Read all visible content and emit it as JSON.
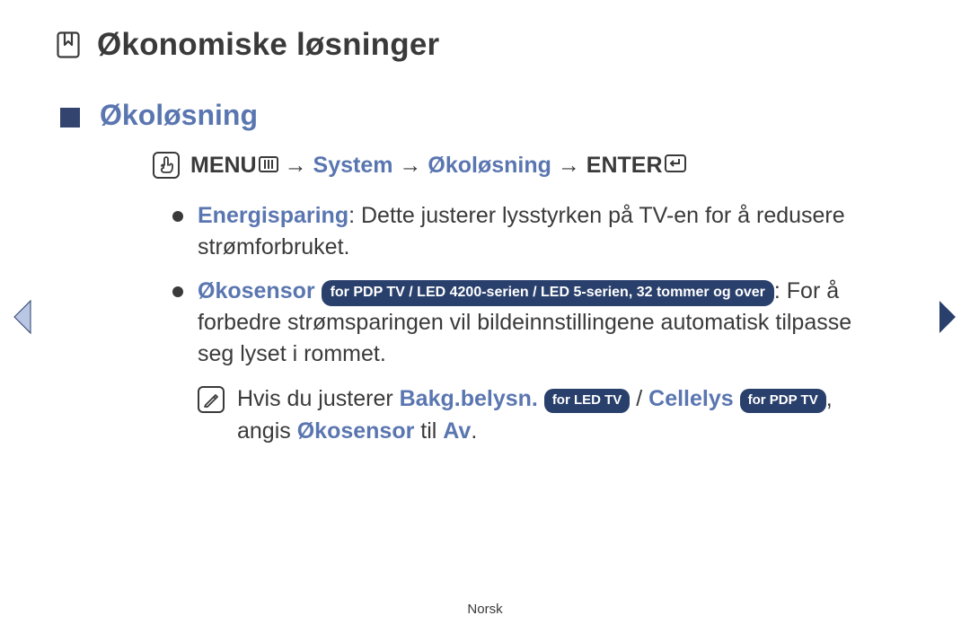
{
  "header": {
    "title": "Økonomiske løsninger",
    "subtitle": "Økoløsning"
  },
  "menu_path": {
    "menu_label": "MENU",
    "sep": "→",
    "system": "System",
    "oko": "Økoløsning",
    "enter_label": "ENTER"
  },
  "items": {
    "energisparing": {
      "term": "Energisparing",
      "text_after": ": Dette justerer lysstyrken på TV-en for å redusere strømforbruket."
    },
    "okosensor": {
      "term": "Økosensor",
      "pill1": "for PDP TV / LED 4200-serien / LED 5-serien, 32 tommer og over",
      "text_after": ": For å forbedre strømsparingen vil bildeinnstillingene automatisk tilpasse seg lyset i rommet."
    }
  },
  "note": {
    "pre": "Hvis du justerer ",
    "bakg": "Bakg.belysn.",
    "pill_led": "for LED TV",
    "slash": " / ",
    "cell": "Cellelys",
    "pill_pdp": "for PDP TV",
    "angis": ", angis ",
    "oko2": "Økosensor",
    "til": " til ",
    "av": "Av",
    "dot": "."
  },
  "footer": "Norsk"
}
